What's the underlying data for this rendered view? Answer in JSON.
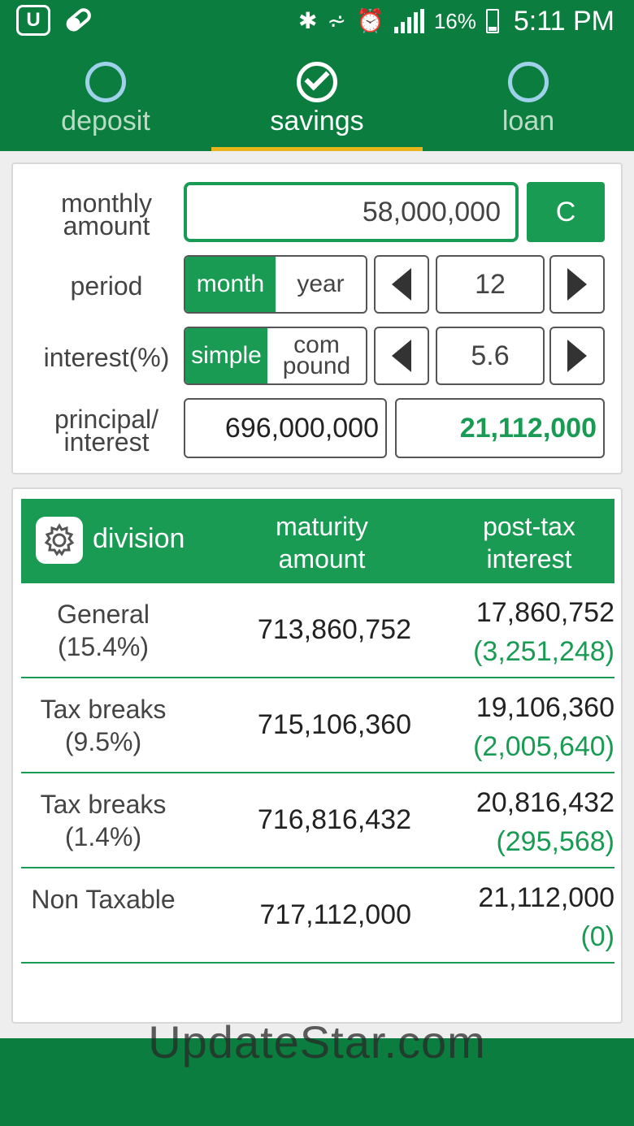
{
  "status_bar": {
    "battery": "16%",
    "time": "5:11 PM"
  },
  "tabs": [
    {
      "label": "deposit",
      "active": false
    },
    {
      "label": "savings",
      "active": true
    },
    {
      "label": "loan",
      "active": false
    }
  ],
  "form": {
    "monthly_amount_label": "monthly amount",
    "monthly_amount_value": "58,000,000",
    "clear_label": "C",
    "period_label": "period",
    "period_options": [
      "month",
      "year"
    ],
    "period_selected": "month",
    "period_value": "12",
    "interest_label": "interest(%)",
    "interest_options": [
      "simple",
      "com pound"
    ],
    "interest_selected": "simple",
    "interest_value": "5.6",
    "principal_interest_label": "principal/ interest",
    "principal_value": "696,000,000",
    "interest_total_value": "21,112,000"
  },
  "table": {
    "headers": {
      "division": "division",
      "maturity": "maturity amount",
      "post_tax": "post-tax interest"
    },
    "rows": [
      {
        "division": "General (15.4%)",
        "maturity": "713,860,752",
        "interest": "17,860,752",
        "tax": "(3,251,248)"
      },
      {
        "division": "Tax breaks (9.5%)",
        "maturity": "715,106,360",
        "interest": "19,106,360",
        "tax": "(2,005,640)"
      },
      {
        "division": "Tax breaks (1.4%)",
        "maturity": "716,816,432",
        "interest": "20,816,432",
        "tax": "(295,568)"
      },
      {
        "division": "Non Taxable",
        "maturity": "717,112,000",
        "interest": "21,112,000",
        "tax": "(0)"
      }
    ]
  },
  "watermark": "UpdateStar.com",
  "colors": {
    "primary_dark": "#0b7d3e",
    "primary": "#1a9b54",
    "tab_underline": "#e8b51c"
  }
}
